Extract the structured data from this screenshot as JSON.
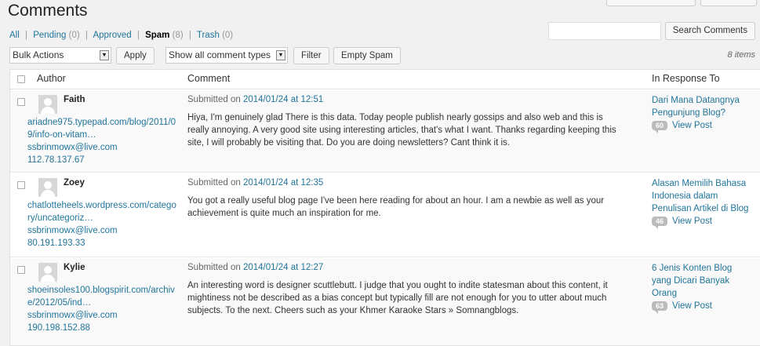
{
  "page": {
    "title": "Comments"
  },
  "filters": [
    {
      "label": "All",
      "count": "",
      "current": false
    },
    {
      "label": "Pending",
      "count": "(0)",
      "current": false
    },
    {
      "label": "Approved",
      "count": "",
      "current": false
    },
    {
      "label": "Spam",
      "count": "(8)",
      "current": true
    },
    {
      "label": "Trash",
      "count": "(0)",
      "current": false
    }
  ],
  "search": {
    "value": "",
    "button_label": "Search Comments"
  },
  "tablenav": {
    "bulk_actions": "Bulk Actions",
    "apply_label": "Apply",
    "comment_type": "Show all comment types",
    "filter_label": "Filter",
    "empty_spam_label": "Empty Spam",
    "items_count": "8 items"
  },
  "columns": {
    "author": "Author",
    "comment": "Comment",
    "response": "In Response To"
  },
  "comments": [
    {
      "author": "Faith",
      "url": "ariadne975.typepad.com/blog/2011/09/info-on-vitam…",
      "email": "ssbrinmowx@live.com",
      "ip": "112.78.137.67",
      "submitted_prefix": "Submitted on",
      "date": "2014/01/24 at 12:51",
      "text": "Hiya, I'm genuinely glad There is this data. Today people publish nearly gossips and also web and this is really annoying. A very good site using interesting articles, that's what I want. Thanks regarding keeping this site, I will probably be visiting that. Do you are doing newsletters? Cant think it is.",
      "response_title": "Dari Mana Datangnya Pengunjung Blog?",
      "response_count": "60",
      "view_post": "View Post"
    },
    {
      "author": "Zoey",
      "url": "chatlotteheels.wordpress.com/category/uncategoriz…",
      "email": "ssbrinmowx@live.com",
      "ip": "80.191.193.33",
      "submitted_prefix": "Submitted on",
      "date": "2014/01/24 at 12:35",
      "text": "You got a really useful blog page I've been here reading for about an hour. I am a newbie as well as your achievement is quite much an inspiration for me.",
      "response_title": "Alasan Memilih Bahasa Indonesia dalam Penulisan Artikel di Blog",
      "response_count": "46",
      "view_post": "View Post"
    },
    {
      "author": "Kylie",
      "url": "shoeinsoles100.blogspirit.com/archive/2012/05/ind…",
      "email": "ssbrinmowx@live.com",
      "ip": "190.198.152.88",
      "submitted_prefix": "Submitted on",
      "date": "2014/01/24 at 12:27",
      "text": "An interesting word is designer scuttlebutt. I judge that you ought to indite statesman about this content, it mightiness not be described as a bias concept but typically fill are not enough for you to utter about much subjects. To the next. Cheers such as your Khmer Karaoke Stars » Somnangblogs.",
      "response_title": "6 Jenis Konten Blog yang Dicari Banyak Orang",
      "response_count": "63",
      "view_post": "View Post"
    }
  ]
}
